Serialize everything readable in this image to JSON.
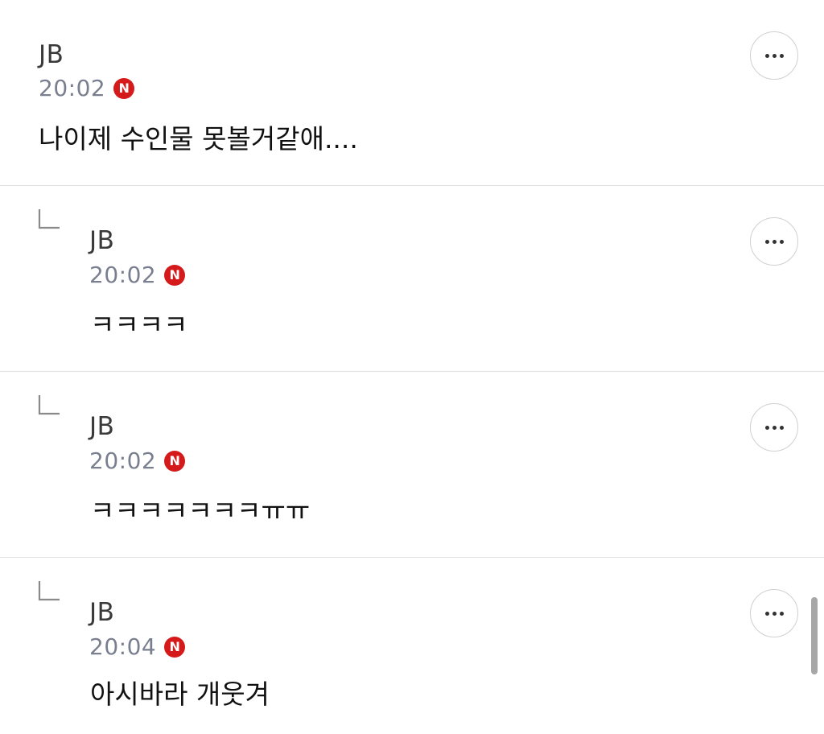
{
  "comments": [
    {
      "author": "JB",
      "time": "20:02",
      "badge": "N",
      "text": "나이제 수인물 못볼거같애....",
      "is_reply": false
    },
    {
      "author": "JB",
      "time": "20:02",
      "badge": "N",
      "text": "ㅋㅋㅋㅋ",
      "is_reply": true
    },
    {
      "author": "JB",
      "time": "20:02",
      "badge": "N",
      "text": "ㅋㅋㅋㅋㅋㅋㅋㅠㅠ",
      "is_reply": true
    },
    {
      "author": "JB",
      "time": "20:04",
      "badge": "N",
      "text": "아시바라 개웃겨",
      "is_reply": true
    }
  ],
  "icons": {
    "more": "more-horizontal-icon",
    "reply": "reply-arrow-icon",
    "badge": "naver-n-badge-icon"
  },
  "colors": {
    "badge": "#d41a1a",
    "time": "#7a7f8f",
    "author": "#3a3a3a",
    "divider": "#e2e2e2"
  }
}
